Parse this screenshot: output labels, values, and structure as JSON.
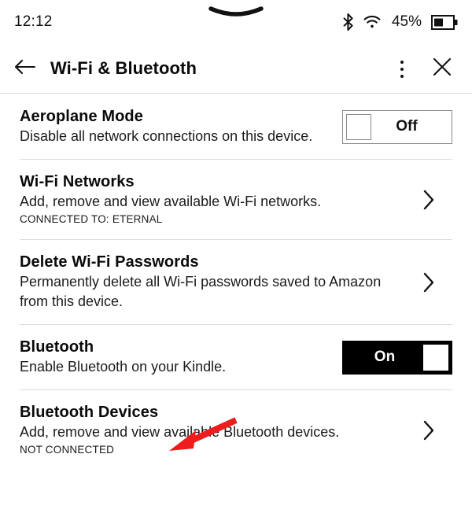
{
  "status_bar": {
    "time": "12:12",
    "battery_percent": "45%",
    "battery_level": 45,
    "icons": [
      "drag-handle-chevron",
      "bluetooth-icon",
      "wifi-icon",
      "battery-icon"
    ]
  },
  "header": {
    "title": "Wi-Fi & Bluetooth",
    "back_icon": "arrow-left-icon",
    "menu_icon": "kebab-menu-icon",
    "close_icon": "close-icon"
  },
  "settings": [
    {
      "title": "Aeroplane Mode",
      "description": "Disable all network connections on this device.",
      "status": "",
      "control": "toggle",
      "toggle_state": "Off",
      "toggle_on": false
    },
    {
      "title": "Wi-Fi Networks",
      "description": "Add, remove and view available Wi-Fi networks.",
      "status": "CONNECTED TO: ETERNAL",
      "control": "chevron",
      "toggle_state": "",
      "toggle_on": false
    },
    {
      "title": "Delete Wi-Fi Passwords",
      "description": "Permanently delete all Wi-Fi passwords saved to Amazon from this device.",
      "status": "",
      "control": "chevron",
      "toggle_state": "",
      "toggle_on": false
    },
    {
      "title": "Bluetooth",
      "description": "Enable Bluetooth on your Kindle.",
      "status": "",
      "control": "toggle",
      "toggle_state": "On",
      "toggle_on": true
    },
    {
      "title": "Bluetooth Devices",
      "description": "Add, remove and view available Bluetooth devices.",
      "status": "NOT CONNECTED",
      "control": "chevron",
      "toggle_state": "",
      "toggle_on": false
    }
  ],
  "annotation": {
    "type": "arrow",
    "color": "#ee1c1c",
    "points_at": "Bluetooth Devices"
  },
  "colors": {
    "background": "#ffffff",
    "text": "#0a0a0a",
    "divider": "#dcdcdc",
    "toggle_on_bg": "#000000",
    "annotation": "#ee1c1c"
  }
}
